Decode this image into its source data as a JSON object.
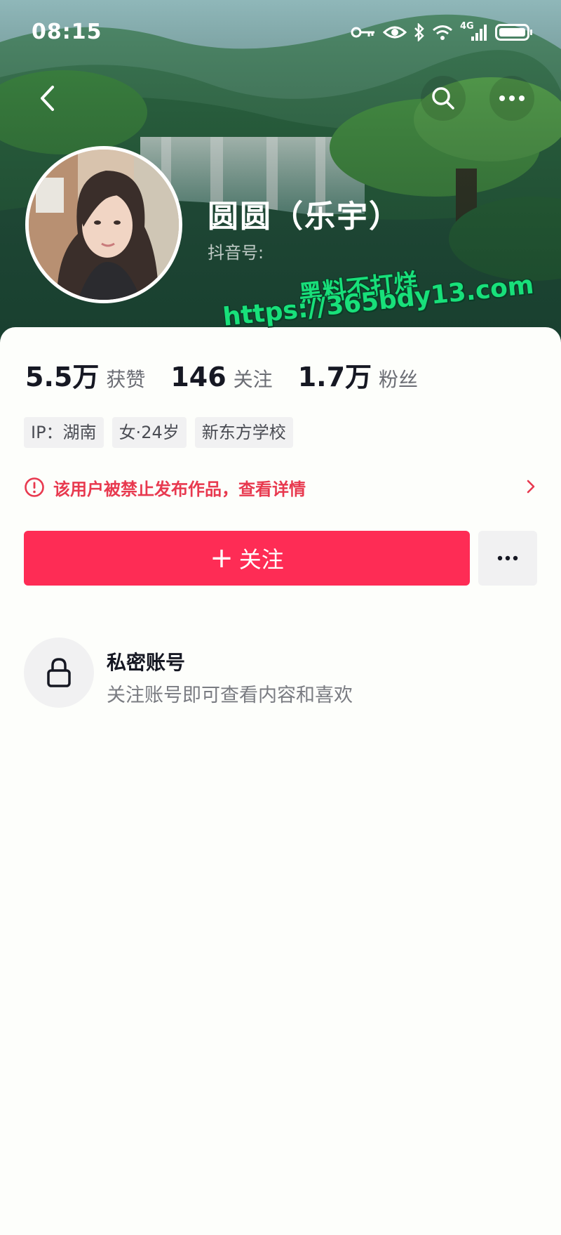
{
  "status_bar": {
    "time": "08:15",
    "network": "4G"
  },
  "profile": {
    "nickname": "圆圆（乐宇）",
    "douyin_id_label": "抖音号:"
  },
  "watermark": {
    "line1": "黑料不打烊",
    "line2": "https://365bdy13.com"
  },
  "stats": [
    {
      "value": "5.5万",
      "label": "获赞"
    },
    {
      "value": "146",
      "label": "关注"
    },
    {
      "value": "1.7万",
      "label": "粉丝"
    }
  ],
  "tags": [
    "IP：湖南",
    "女·24岁",
    "新东方学校"
  ],
  "ban_notice": "该用户被禁止发布作品，查看详情",
  "actions": {
    "follow_plus": "+",
    "follow_label": "关注"
  },
  "private_account": {
    "title": "私密账号",
    "description": "关注账号即可查看内容和喜欢"
  },
  "colors": {
    "accent": "#fe2c55",
    "warning": "#e8394f",
    "watermark": "#18e07a"
  },
  "icons": [
    "back-icon",
    "search-icon",
    "more-icon",
    "key-icon",
    "eye-icon",
    "bluetooth-icon",
    "wifi-icon",
    "signal-icon",
    "battery-icon",
    "alert-icon",
    "chevron-right-icon",
    "lock-icon"
  ]
}
